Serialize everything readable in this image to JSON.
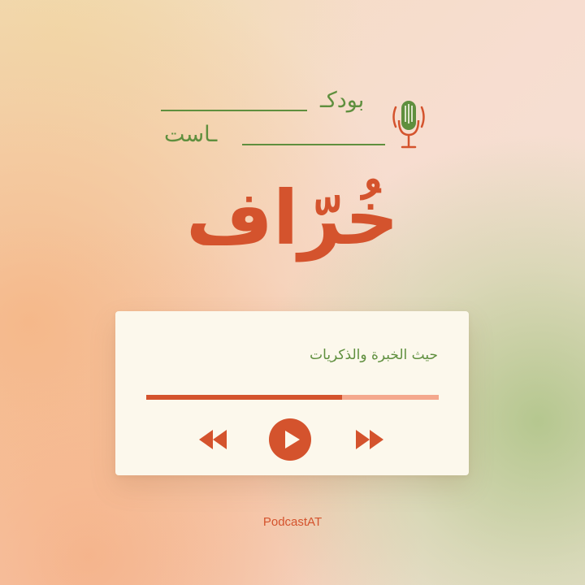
{
  "brand": {
    "word_top": "بودكـ",
    "word_bottom": "ـاست",
    "icon": "microphone-icon",
    "color": "#5f8f3e"
  },
  "show": {
    "title": "خُرّاف",
    "subtitle": "حيث الخبرة والذكريات",
    "accent_color": "#d4532d"
  },
  "player": {
    "progress": 0.67,
    "controls": {
      "rewind_icon": "rewind-icon",
      "play_icon": "play-icon",
      "forward_icon": "fast-forward-icon"
    }
  },
  "footer": {
    "handle": "PodcastAT"
  }
}
